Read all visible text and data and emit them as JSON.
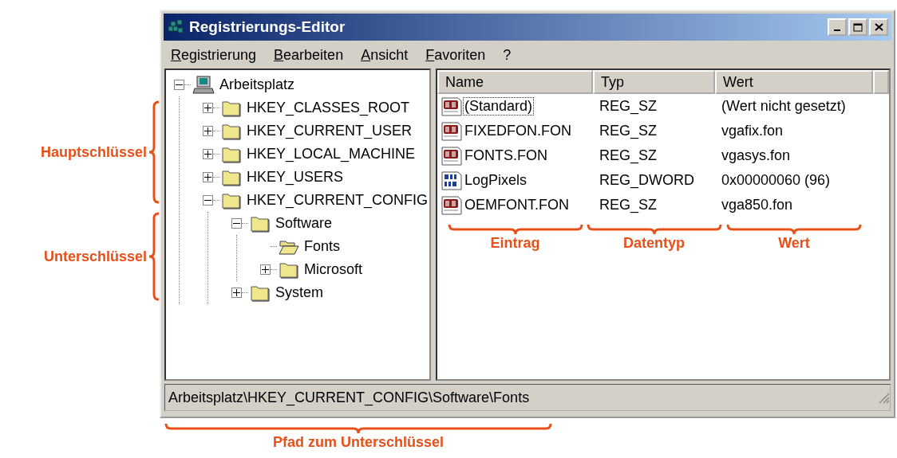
{
  "window": {
    "title": "Registrierungs-Editor"
  },
  "menu": [
    "Registrierung",
    "Bearbeiten",
    "Ansicht",
    "Favoriten",
    "?"
  ],
  "tree": [
    {
      "label": "Arbeitsplatz",
      "kind": "computer",
      "expanded": true,
      "children": [
        {
          "label": "HKEY_CLASSES_ROOT",
          "kind": "folder",
          "expanded": false,
          "selected": false
        },
        {
          "label": "HKEY_CURRENT_USER",
          "kind": "folder",
          "expanded": false,
          "selected": false
        },
        {
          "label": "HKEY_LOCAL_MACHINE",
          "kind": "folder",
          "expanded": false,
          "selected": false
        },
        {
          "label": "HKEY_USERS",
          "kind": "folder",
          "expanded": false,
          "selected": false
        },
        {
          "label": "HKEY_CURRENT_CONFIG",
          "kind": "folder",
          "expanded": true,
          "selected": false,
          "children": [
            {
              "label": "Software",
              "kind": "folder",
              "expanded": true,
              "selected": false,
              "children": [
                {
                  "label": "Fonts",
                  "kind": "folder",
                  "selected": true
                },
                {
                  "label": "Microsoft",
                  "kind": "folder",
                  "expanded": false,
                  "selected": false
                }
              ]
            },
            {
              "label": "System",
              "kind": "folder",
              "expanded": false,
              "selected": false
            }
          ]
        }
      ]
    }
  ],
  "table": {
    "columns": [
      "Name",
      "Typ",
      "Wert"
    ],
    "rows": [
      {
        "kind": "string",
        "name": "(Standard)",
        "type": "REG_SZ",
        "value": "(Wert nicht gesetzt)",
        "focused": true
      },
      {
        "kind": "string",
        "name": "FIXEDFON.FON",
        "type": "REG_SZ",
        "value": "vgafix.fon",
        "focused": false
      },
      {
        "kind": "string",
        "name": "FONTS.FON",
        "type": "REG_SZ",
        "value": "vgasys.fon",
        "focused": false
      },
      {
        "kind": "dword",
        "name": "LogPixels",
        "type": "REG_DWORD",
        "value": "0x00000060 (96)",
        "focused": false
      },
      {
        "kind": "string",
        "name": "OEMFONT.FON",
        "type": "REG_SZ",
        "value": "vga850.fon",
        "focused": false
      }
    ]
  },
  "status_bar": "Arbeitsplatz\\HKEY_CURRENT_CONFIG\\Software\\Fonts",
  "annotations": {
    "tree": [
      "Hauptschlüssel",
      "Unterschlüssel"
    ],
    "columns": [
      "Eintrag",
      "Datentyp",
      "Wert"
    ],
    "status": "Pfad zum Unterschlüssel"
  }
}
